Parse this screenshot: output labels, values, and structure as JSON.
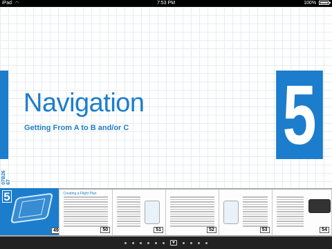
{
  "status_bar": {
    "carrier": "iPad",
    "wifi_icon": "wifi-icon",
    "time": "7:53 PM",
    "battery": "100%"
  },
  "chapter": {
    "number": "5",
    "title": "Navigation",
    "subtitle": "Getting From A to B and/or C",
    "side_code": "07B26 67",
    "accent_color": "#1c7dcc"
  },
  "thumbnails": [
    {
      "page": "49",
      "label": ""
    },
    {
      "page": "50",
      "label": "Creating a Flight Plan"
    },
    {
      "page": "51",
      "label": ""
    },
    {
      "page": "52",
      "label": ""
    },
    {
      "page": "53",
      "label": ""
    },
    {
      "page": "54",
      "label": ""
    }
  ],
  "page_dots": {
    "count": 11,
    "current_index": 6
  }
}
